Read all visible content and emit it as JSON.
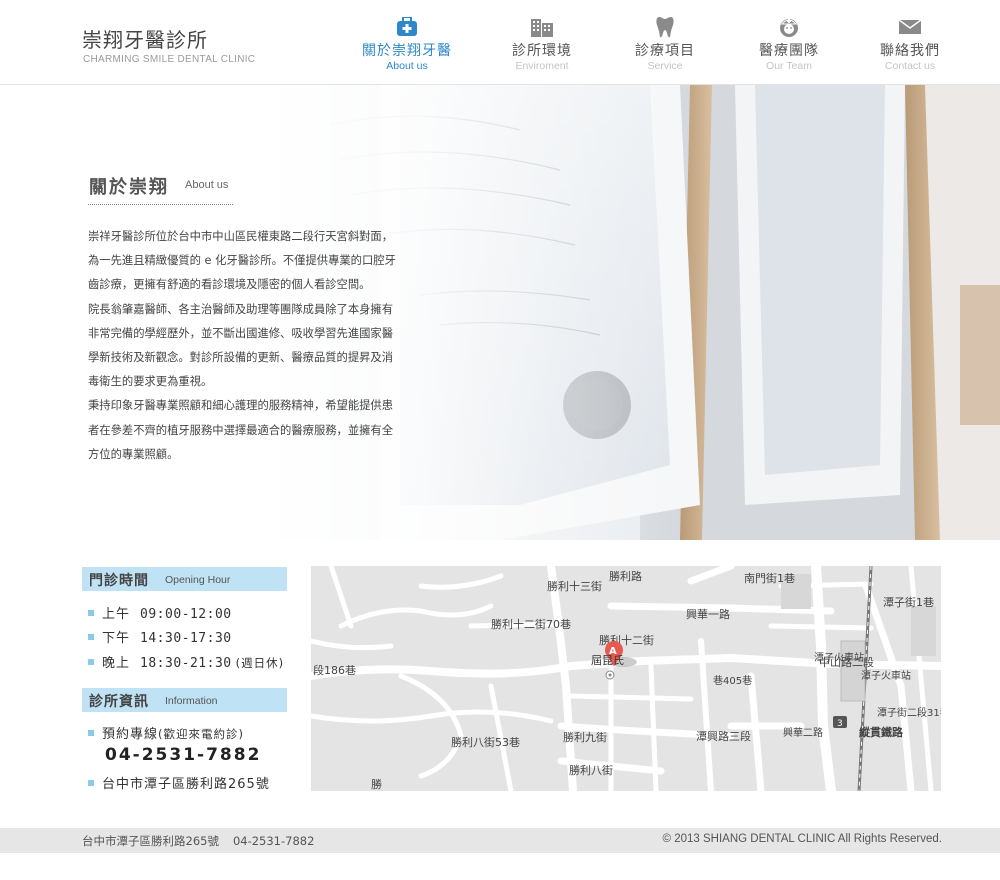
{
  "brand": {
    "name_zh": "崇翔牙醫診所",
    "name_en": "CHARMING SMILE DENTAL CLINIC"
  },
  "nav": [
    {
      "zh": "關於崇翔牙醫",
      "en": "About us",
      "icon": "medical-kit-icon",
      "active": true
    },
    {
      "zh": "診所環境",
      "en": "Enviroment",
      "icon": "building-icon",
      "active": false
    },
    {
      "zh": "診療項目",
      "en": "Service",
      "icon": "tooth-icon",
      "active": false
    },
    {
      "zh": "醫療團隊",
      "en": "Our Team",
      "icon": "nurse-icon",
      "active": false
    },
    {
      "zh": "聯絡我們",
      "en": "Contact us",
      "icon": "envelope-icon",
      "active": false
    }
  ],
  "about": {
    "title_zh": "關於崇翔",
    "title_en": "About us",
    "lines": [
      "崇祥牙醫診所位於台中市中山區民權東路二段行天宮斜對面，",
      "為一先進且精緻優質的 e 化牙醫診所。不僅提供專業的口腔牙",
      "齒診療，更擁有舒適的看診環境及隱密的個人看診空間。",
      "院長翁肇嘉醫師、各主治醫師及助理等團隊成員除了本身擁有",
      "非常完備的學經歷外，並不斷出國進修、吸收學習先進國家醫",
      "學新技術及新觀念。對診所設備的更新、醫療品質的提昇及消",
      "毒衛生的要求更為重視。",
      "秉持印象牙醫專業照顧和細心護理的服務精神，希望能提供患",
      "者在參差不齊的植牙服務中選擇最適合的醫療服務，並擁有全",
      "方位的專業照顧。"
    ]
  },
  "hours": {
    "title_zh": "門診時間",
    "title_en": "Opening Hour",
    "rows": [
      {
        "label": "上午",
        "time": "09:00-12:00",
        "note": ""
      },
      {
        "label": "下午",
        "time": "14:30-17:30",
        "note": ""
      },
      {
        "label": "晚上",
        "time": "18:30-21:30",
        "note": "(週日休)"
      }
    ]
  },
  "info": {
    "title_zh": "診所資訊",
    "title_en": "Information",
    "phone_label": "預約專線",
    "phone_note": "(歡迎來電約診)",
    "phone": "04-2531-7882",
    "address": "台中市潭子區勝利路265號"
  },
  "map": {
    "marker": "A",
    "marker_label": "屆昆氏",
    "labels": [
      "勝利十三街",
      "勝利十二街70巷",
      "勝利十二街",
      "興華一路",
      "勝利九街",
      "勝利八街53巷",
      "勝利八街",
      "潭興路三段",
      "南門街1巷",
      "中山路二段",
      "潭子火車站",
      "潭子火車站",
      "縱貫鐵路",
      "段186巷",
      "潭子街1巷",
      "勝利路",
      "勝",
      "潭子街二段31巷",
      "興華二路",
      "巷405巷",
      "3"
    ]
  },
  "footer": {
    "address": "台中市潭子區勝利路265號",
    "phone": "04-2531-7882",
    "copyright": "© 2013 SHIANG DENTAL CLINIC All Rights Reserved."
  },
  "colors": {
    "accent": "#2d87c8",
    "bar": "#bfe2f4",
    "bullet": "#8ccbe8",
    "marker": "#e85a50"
  }
}
